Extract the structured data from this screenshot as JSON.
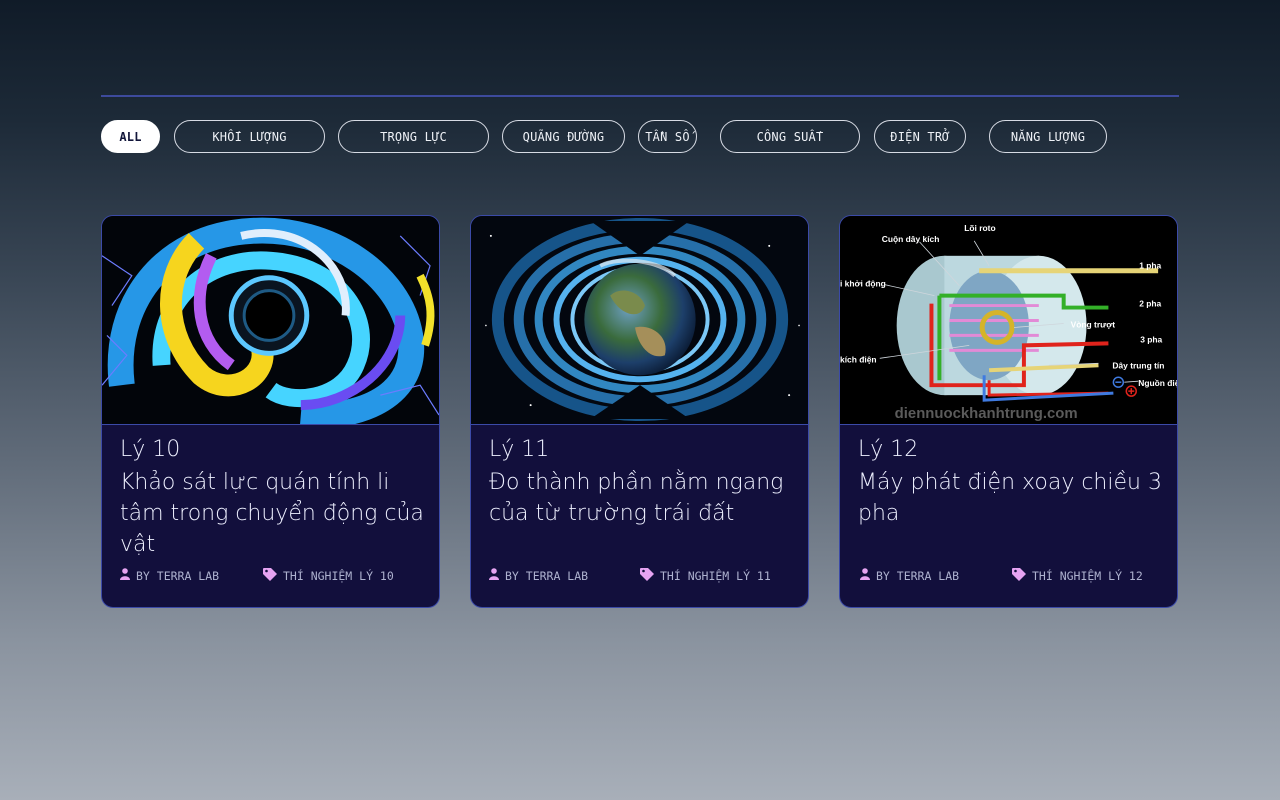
{
  "filters": [
    "ALL",
    "KHỐI LƯỢNG",
    "TRỌNG LỰC",
    "QUÃNG ĐƯỜNG",
    "TẦN SỐ",
    "CÔNG SUẤT",
    "ĐIỆN TRỞ",
    "NĂNG LƯỢNG"
  ],
  "active_filter": "ALL",
  "cards": [
    {
      "grade": "Lý 10",
      "title": "Khảo sát lực quán tính li tâm trong chuyển động của vật",
      "author": "BY TERRA LAB",
      "tag": "THÍ NGHIỆM LÝ 10",
      "image_icon": "colorful-swirl-image"
    },
    {
      "grade": "Lý 11",
      "title": "Đo thành phần nằm ngang của từ trường trái đất",
      "author": "BY TERRA LAB",
      "tag": "THÍ NGHIỆM LÝ 11",
      "image_icon": "earth-magnetic-field-image"
    },
    {
      "grade": "Lý 12",
      "title": "Máy phát điện xoay chiều 3 pha",
      "author": "BY TERRA LAB",
      "tag": "THÍ NGHIỆM LÝ 12",
      "image_icon": "three-phase-generator-diagram",
      "diagram_labels": {
        "loi_roto": "Lõi roto",
        "cuon_day_kich": "Cuộn dây kích",
        "khoi_dong": "i khởi động",
        "mot_pha": "1 pha",
        "hai_pha": "2 pha",
        "vong_truot": "Vòng trượt",
        "ba_pha": "3 pha",
        "kich_dien": "kích điện",
        "day_trung_tinh": "Dây trung tín",
        "nguon_dien": "Nguồn điệ",
        "watermark": "diennuockhanhtrung.com"
      }
    }
  ],
  "colors": {
    "card_bg": "#120f3c",
    "card_border": "#3b4aa8",
    "meta_icon": "#e6a3f2",
    "divider": "#3d4a9c"
  }
}
